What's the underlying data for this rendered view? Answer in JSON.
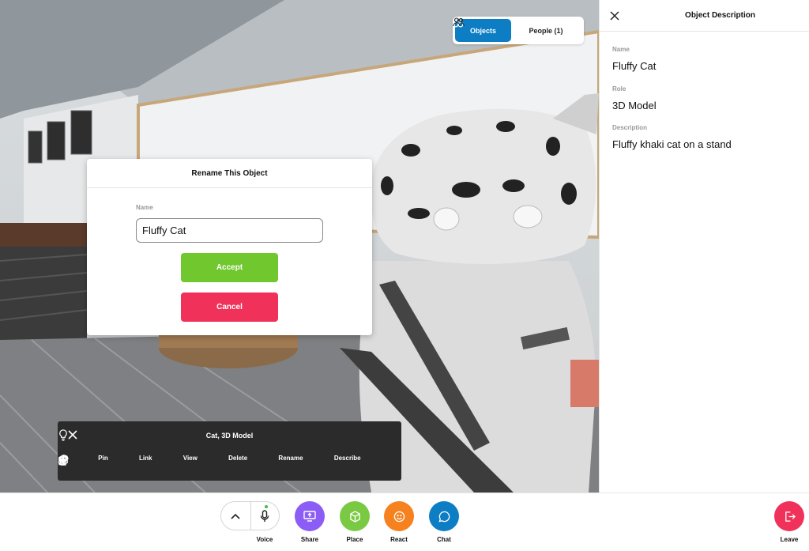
{
  "toggle": {
    "objects_label": "Objects",
    "people_label": "People (1)"
  },
  "rename_dialog": {
    "title": "Rename This Object",
    "name_label": "Name",
    "name_value": "Fluffy Cat",
    "accept_label": "Accept",
    "cancel_label": "Cancel"
  },
  "object_bar": {
    "title": "Cat, 3D Model",
    "actions": [
      {
        "label": "Pin",
        "icon": "pin-icon"
      },
      {
        "label": "Link",
        "icon": "link-icon"
      },
      {
        "label": "View",
        "icon": "walk-icon"
      },
      {
        "label": "Delete",
        "icon": "trash-icon"
      },
      {
        "label": "Rename",
        "icon": "cube-icon"
      },
      {
        "label": "Describe",
        "icon": "plus-icon"
      }
    ]
  },
  "panel": {
    "title": "Object Description",
    "name_label": "Name",
    "name_value": "Fluffy Cat",
    "role_label": "Role",
    "role_value": "3D Model",
    "description_label": "Description",
    "description_value": "Fluffy khaki cat on a stand"
  },
  "bottombar": {
    "voice_label": "Voice",
    "share_label": "Share",
    "place_label": "Place",
    "react_label": "React",
    "chat_label": "Chat",
    "leave_label": "Leave"
  },
  "colors": {
    "objects_active": "#0d7dc4",
    "accept": "#71c72e",
    "cancel": "#f0325a",
    "share": "#8b5cf6",
    "place": "#7ac943",
    "react": "#f5821f",
    "chat": "#0d7dc4",
    "leave": "#f0325a"
  }
}
